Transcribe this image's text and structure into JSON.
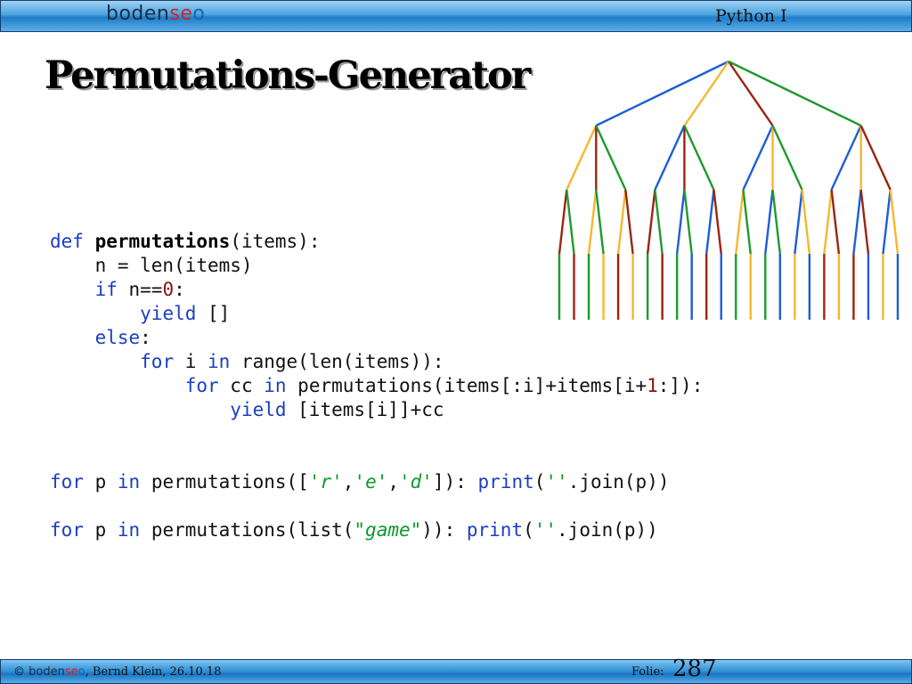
{
  "header": {
    "logo": {
      "part1": "boden",
      "part2": "se",
      "part3": "o"
    },
    "course": "Python I"
  },
  "slide": {
    "title": "Permutations-Generator"
  },
  "tree": {
    "colors": {
      "blue": "#1c5ed8",
      "yellow": "#f5b82e",
      "red": "#9a2410",
      "green": "#1e9a2e"
    }
  },
  "code": {
    "l1": {
      "kw": "def",
      "name": "permutations",
      "rest": "(items):"
    },
    "l2": {
      "text": "    n = len(items)"
    },
    "l3": {
      "kw": "if",
      "mid": " n==",
      "num": "0",
      "end": ":"
    },
    "l4": {
      "kw": "yield",
      "rest": " []"
    },
    "l5": {
      "kw": "else",
      "rest": ":"
    },
    "l6": {
      "kw1": "for",
      "a": " i ",
      "kw2": "in",
      "b": " range(len(items)):"
    },
    "l7": {
      "kw1": "for",
      "a": " cc ",
      "kw2": "in",
      "b": " permutations(items[:i]+items[i+",
      "num": "1",
      "c": ":]):"
    },
    "l8": {
      "kw": "yield",
      "rest": " [items[i]]+cc"
    },
    "l9": {
      "kw1": "for",
      "a": " p ",
      "kw2": "in",
      "b": " permutations([",
      "s1": "'r'",
      "c1": ",",
      "s2": "'e'",
      "c2": ",",
      "s3": "'d'",
      "c": "]): ",
      "kw3": "print",
      "d": "(",
      "s4": "''",
      "e": ".join(p))"
    },
    "l10": {
      "kw1": "for",
      "a": " p ",
      "kw2": "in",
      "b": " permutations(list(",
      "q1": "\"",
      "s1": "game",
      "q2": "\"",
      "c": ")): ",
      "kw3": "print",
      "d": "(",
      "s2": "''",
      "e": ".join(p))"
    }
  },
  "footer": {
    "copyright_prefix": "© ",
    "logo": {
      "part1": "boden",
      "part2": "se",
      "part3": "o"
    },
    "author": ", Bernd Klein, 26.10.18",
    "folie_label": "Folie:",
    "slide_number": "287"
  }
}
